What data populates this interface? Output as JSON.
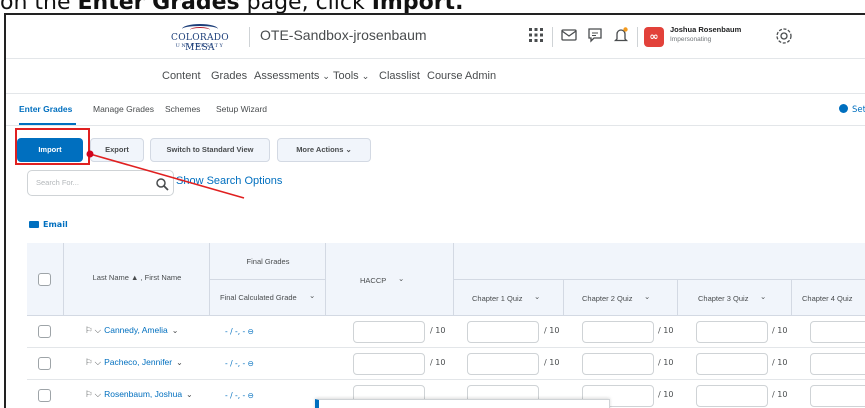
{
  "instruction": {
    "part1": "on the ",
    "bold1": "Enter Grades",
    "part2": " page, click ",
    "bold2": "Import."
  },
  "header": {
    "logo_line1": "COLORADO MESA",
    "logo_line2": "UNIVERSITY",
    "org_title": "OTE-Sandbox-jrosenbaum",
    "user_initials": "∞",
    "user_name": "Joshua Rosenbaum",
    "user_role": "Impersonating"
  },
  "nav": {
    "items": [
      "Content",
      "Grades",
      "Assessments",
      "Tools",
      "Classlist",
      "Course Admin"
    ]
  },
  "tabs": {
    "items": [
      "Enter Grades",
      "Manage Grades",
      "Schemes",
      "Setup Wizard"
    ],
    "settings": "Sett"
  },
  "actions": {
    "import": "Import",
    "export": "Export",
    "switch_view": "Switch to Standard View",
    "more_actions": "More Actions"
  },
  "search": {
    "placeholder": "Search For...",
    "show_options": "Show Search Options"
  },
  "email_label": "Email",
  "grid": {
    "col_name": "Last Name ▲ , First Name",
    "col_final_group": "Final Grades",
    "col_final_calc": "Final Calculated Grade",
    "col_haccp": "HACCP",
    "col_ch1": "Chapter 1 Quiz",
    "col_ch2": "Chapter 2 Quiz",
    "col_ch3": "Chapter 3 Quiz",
    "col_ch4": "Chapter 4 Quiz",
    "out_of": "/ 10",
    "rows": [
      {
        "name": "Cannedy, Amelia",
        "final": "- / -, - ⊖"
      },
      {
        "name": "Pacheco, Jennifer",
        "final": "- / -, - ⊖"
      },
      {
        "name": "Rosenbaum, Joshua",
        "final": "- / -, - ⊖"
      }
    ]
  },
  "colors": {
    "accent": "#006fbf",
    "highlight": "#e02020",
    "badge": "#e2413a"
  }
}
